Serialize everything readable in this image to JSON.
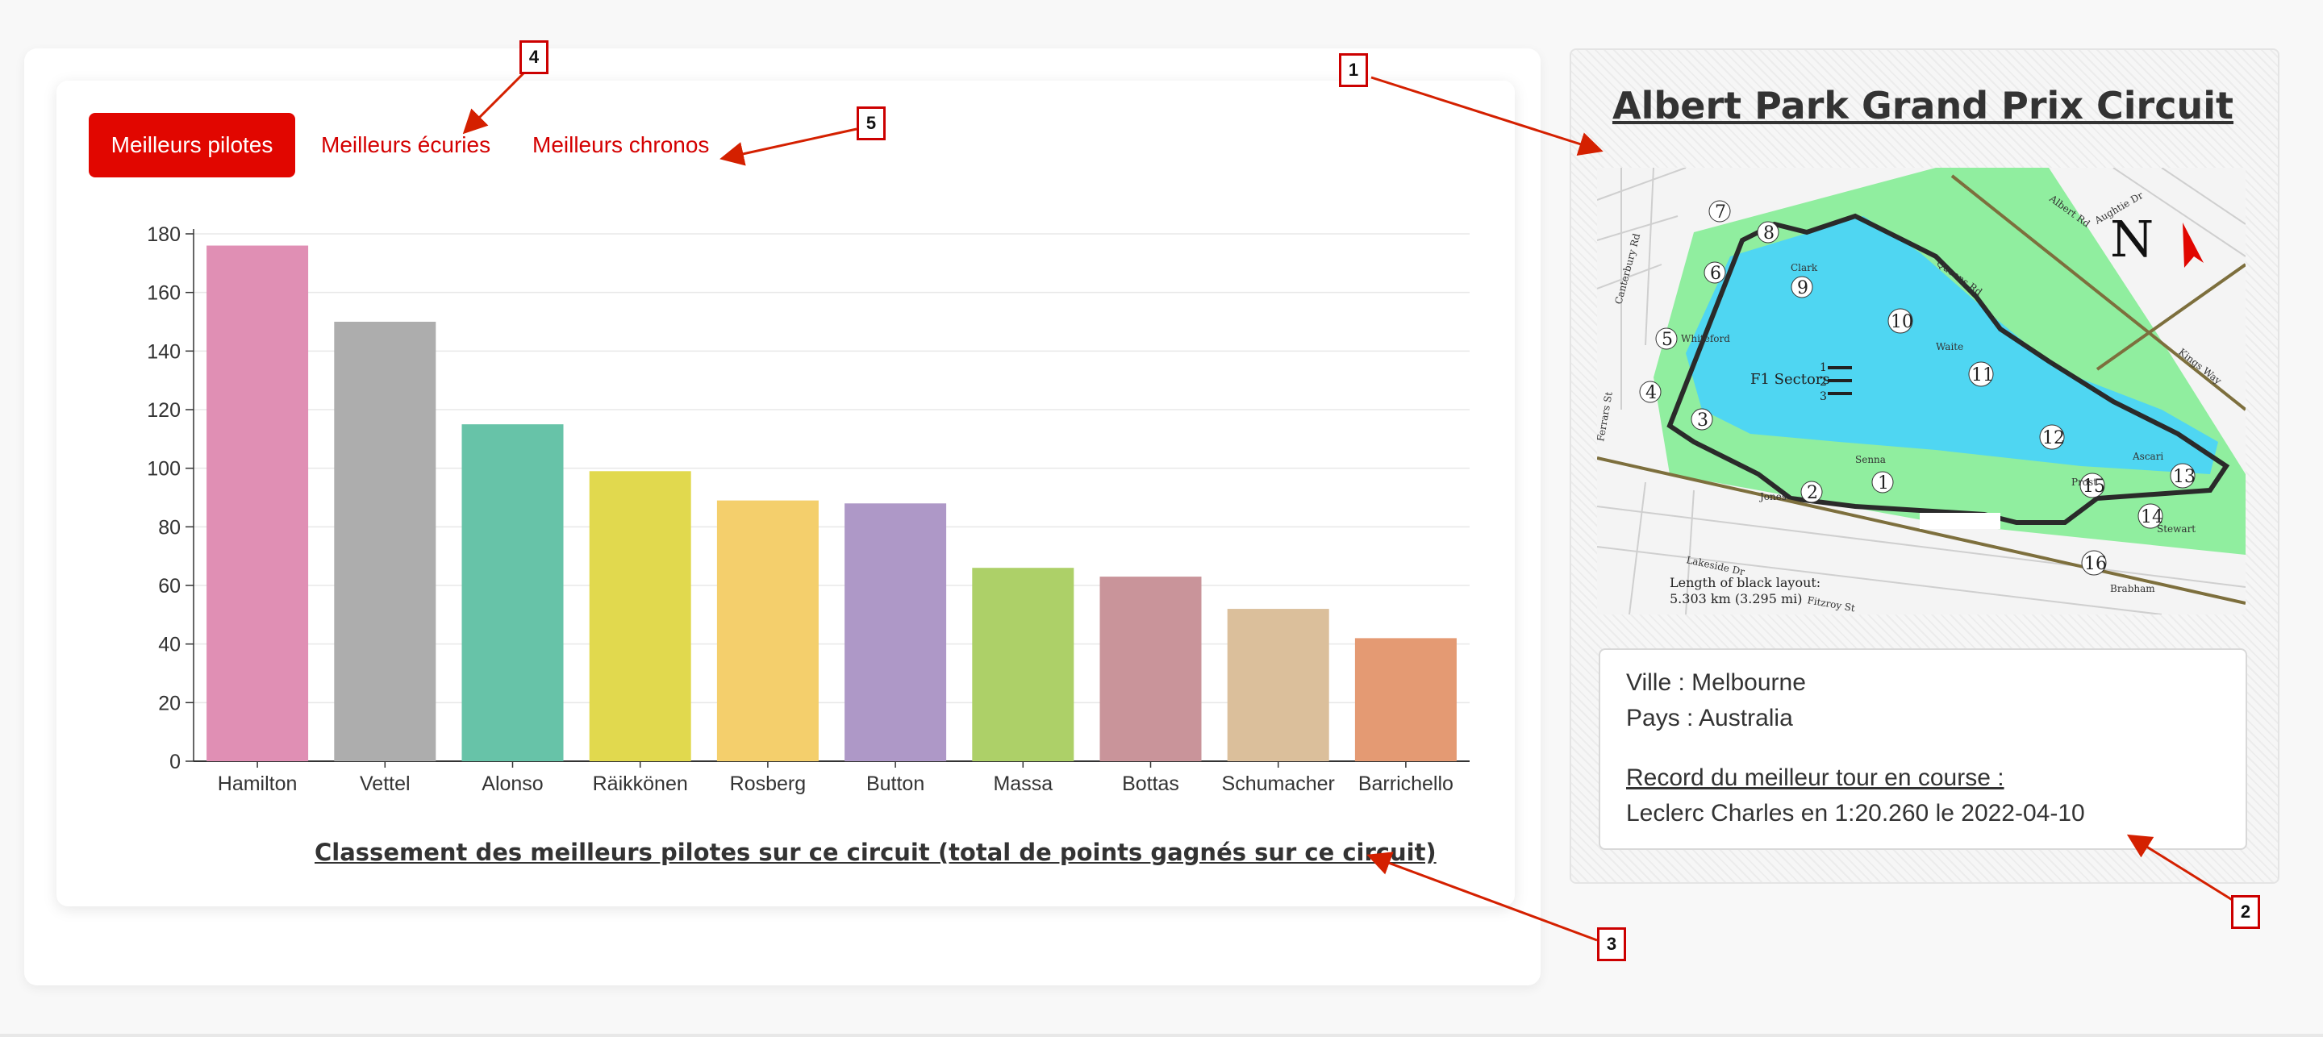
{
  "tabs": {
    "pilotes": "Meilleurs pilotes",
    "ecuries": "Meilleurs écuries",
    "chronos": "Meilleurs chronos"
  },
  "chart_data": {
    "type": "bar",
    "categories": [
      "Hamilton",
      "Vettel",
      "Alonso",
      "Räikkönen",
      "Rosberg",
      "Button",
      "Massa",
      "Bottas",
      "Schumacher",
      "Barrichello"
    ],
    "values": [
      176,
      150,
      115,
      99,
      89,
      88,
      66,
      63,
      52,
      42
    ],
    "colors": [
      "#e08fb4",
      "#adadad",
      "#67c3a8",
      "#e1d94e",
      "#f4cf6c",
      "#ae98c7",
      "#add068",
      "#c9949a",
      "#dbbf9b",
      "#e49a73"
    ],
    "title": "Classement des meilleurs pilotes sur ce circuit (total de points gagnés sur ce circuit)",
    "yticks": [
      0,
      20,
      40,
      60,
      80,
      100,
      120,
      140,
      160,
      180
    ],
    "ylim": [
      0,
      180
    ],
    "grid": true
  },
  "circuit": {
    "name": "Albert Park Grand Prix Circuit",
    "city": "Ville : Melbourne",
    "country": "Pays : Australia",
    "record_label": "Record du meilleur tour en course :",
    "record_value": "Leclerc Charles en 1:20.260 le 2022-04-10"
  },
  "map": {
    "corners": [
      "1",
      "2",
      "3",
      "4",
      "5",
      "6",
      "7",
      "8",
      "9",
      "10",
      "11",
      "12",
      "13",
      "14",
      "15",
      "16"
    ],
    "north": "N",
    "sectors_label": "F1 Sectors",
    "sector_nums": [
      "1",
      "2",
      "3"
    ],
    "corner_names": [
      "Whiteford",
      "Clark",
      "Waite",
      "Ascari",
      "Stewart",
      "Brabham",
      "Jones",
      "Senna",
      "Prost"
    ],
    "roads": [
      "Queens Rd",
      "Lakeside Dr",
      "Albert Rd",
      "Aughtie Dr",
      "Canterbury Rd",
      "Fitzroy St",
      "Kings Way",
      "Ferrars St"
    ],
    "length_text": "Length of black layout:",
    "length_value": "5.303 km (3.295 mi)",
    "colors": {
      "water": "#4fd6f2",
      "grass": "#90ee9f",
      "track": "#2a2a2a"
    }
  },
  "callouts": [
    "1",
    "2",
    "3",
    "4",
    "5"
  ],
  "colors": {
    "accent": "#e10600",
    "tab_text": "#d40000",
    "arrow": "#d42000"
  }
}
